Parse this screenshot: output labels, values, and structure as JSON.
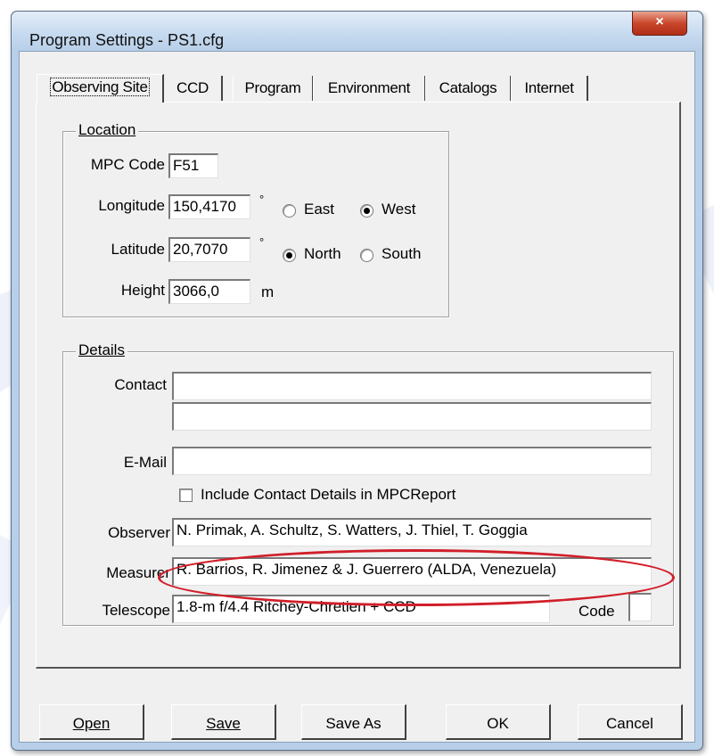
{
  "window": {
    "title": "Program Settings - PS1.cfg",
    "close_label": "×"
  },
  "tabs": [
    {
      "label": "Observing Site"
    },
    {
      "label": "CCD"
    },
    {
      "label": "Program"
    },
    {
      "label": "Environment"
    },
    {
      "label": "Catalogs"
    },
    {
      "label": "Internet"
    }
  ],
  "location": {
    "legend": "Location",
    "mpc_code": {
      "label": "MPC Code",
      "value": "F51"
    },
    "longitude": {
      "label": "Longitude",
      "value": "150,4170",
      "unit": "°",
      "east": "East",
      "west": "West",
      "selected": "West"
    },
    "latitude": {
      "label": "Latitude",
      "value": "20,7070",
      "unit": "°",
      "north": "North",
      "south": "South",
      "selected": "North"
    },
    "height": {
      "label": "Height",
      "value": "3066,0",
      "unit": "m"
    }
  },
  "details": {
    "legend": "Details",
    "contact": {
      "label": "Contact",
      "line1": "",
      "line2": ""
    },
    "email": {
      "label": "E-Mail",
      "value": ""
    },
    "include_contact": {
      "label": "Include Contact Details in MPCReport",
      "checked": false
    },
    "observer": {
      "label": "Observer",
      "value": "N. Primak, A. Schultz, S. Watters, J. Thiel, T. Goggia"
    },
    "measurer": {
      "label": "Measurer",
      "value": "R. Barrios, R. Jimenez & J. Guerrero (ALDA, Venezuela)"
    },
    "telescope": {
      "label": "Telescope",
      "value": "1.8-m f/4.4 Ritchey-Chretien + CCD"
    },
    "code": {
      "label": "Code",
      "value": ""
    }
  },
  "buttons": {
    "open": "Open",
    "save": "Save",
    "save_as": "Save As",
    "ok": "OK",
    "cancel": "Cancel"
  },
  "colors": {
    "annotation": "#d11f2a",
    "titlebar": "#c7dbf0",
    "close": "#c9462b"
  }
}
